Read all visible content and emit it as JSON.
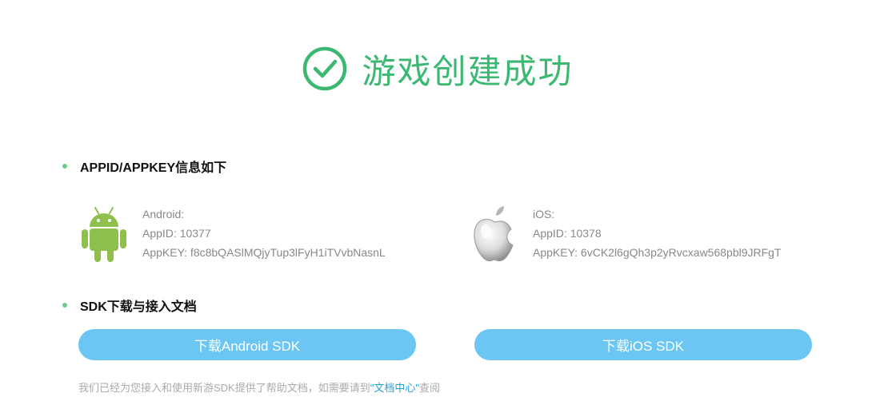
{
  "header": {
    "title": "游戏创建成功",
    "icon": "check-circle-icon",
    "color": "#3bb872"
  },
  "sections": {
    "appinfo_heading": "APPID/APPKEY信息如下",
    "sdk_heading": "SDK下载与接入文档"
  },
  "android": {
    "icon": "android-icon",
    "platform": "Android:",
    "appid": "AppID: 10377",
    "appkey": "AppKEY: f8c8bQASlMQjyTup3lFyH1iTVvbNasnL"
  },
  "ios": {
    "icon": "apple-icon",
    "platform": "iOS:",
    "appid": "AppID: 10378",
    "appkey": "AppKEY: 6vCK2l6gQh3p2yRvcxaw568pbl9JRFgT"
  },
  "buttons": {
    "android_sdk": "下载Android SDK",
    "ios_sdk": "下载iOS SDK",
    "color": "#6cc6f4"
  },
  "note": {
    "prefix": "我们已经为您接入和使用新游SDK提供了帮助文档，如需要请到",
    "link": "\"文档中心\"",
    "suffix": "查阅"
  }
}
